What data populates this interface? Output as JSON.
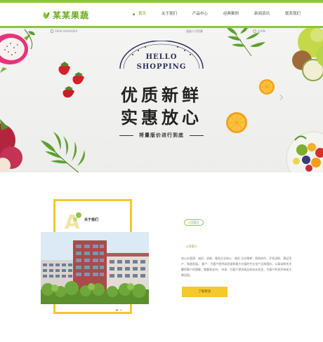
{
  "header": {
    "logo_text": "某某果蔬",
    "nav": [
      {
        "label": "首页",
        "active": true
      },
      {
        "label": "关于我们",
        "active": false
      },
      {
        "label": "产品中心",
        "active": false
      },
      {
        "label": "经典案例",
        "active": false
      },
      {
        "label": "新闻资讯",
        "active": false
      },
      {
        "label": "联系我们",
        "active": false
      }
    ],
    "hotline": "0898-08889888",
    "contact_link": "超级人才招募",
    "lang": "中·EN"
  },
  "banner": {
    "badge_top": "HELLO",
    "badge_bottom": "SHOPPING",
    "headline_1": "优质新鲜",
    "headline_2": "实惠放心",
    "ribbon": "将量版价进行到底"
  },
  "about": {
    "letter": "A",
    "title": "关于我们",
    "tag": "公司简介",
    "intro_label": "· 公司简介 ·",
    "intro_text": "核心价值观：诚信、创新、服务企业核心 · 诚实 企业精神：团结协作、开拓进取、满足用户、和谐发展。 客户：为客户提供高质量和最大价值的专业化产品和服务，以真诚和技术赢得客户的理解、尊重和支持。 市场：为客户提供高品质成长机会，为客户的投资带来丰厚回报。",
    "more_button": "了解更多"
  },
  "colors": {
    "accent_green": "#8cc63f",
    "accent_yellow": "#f5c82d"
  }
}
